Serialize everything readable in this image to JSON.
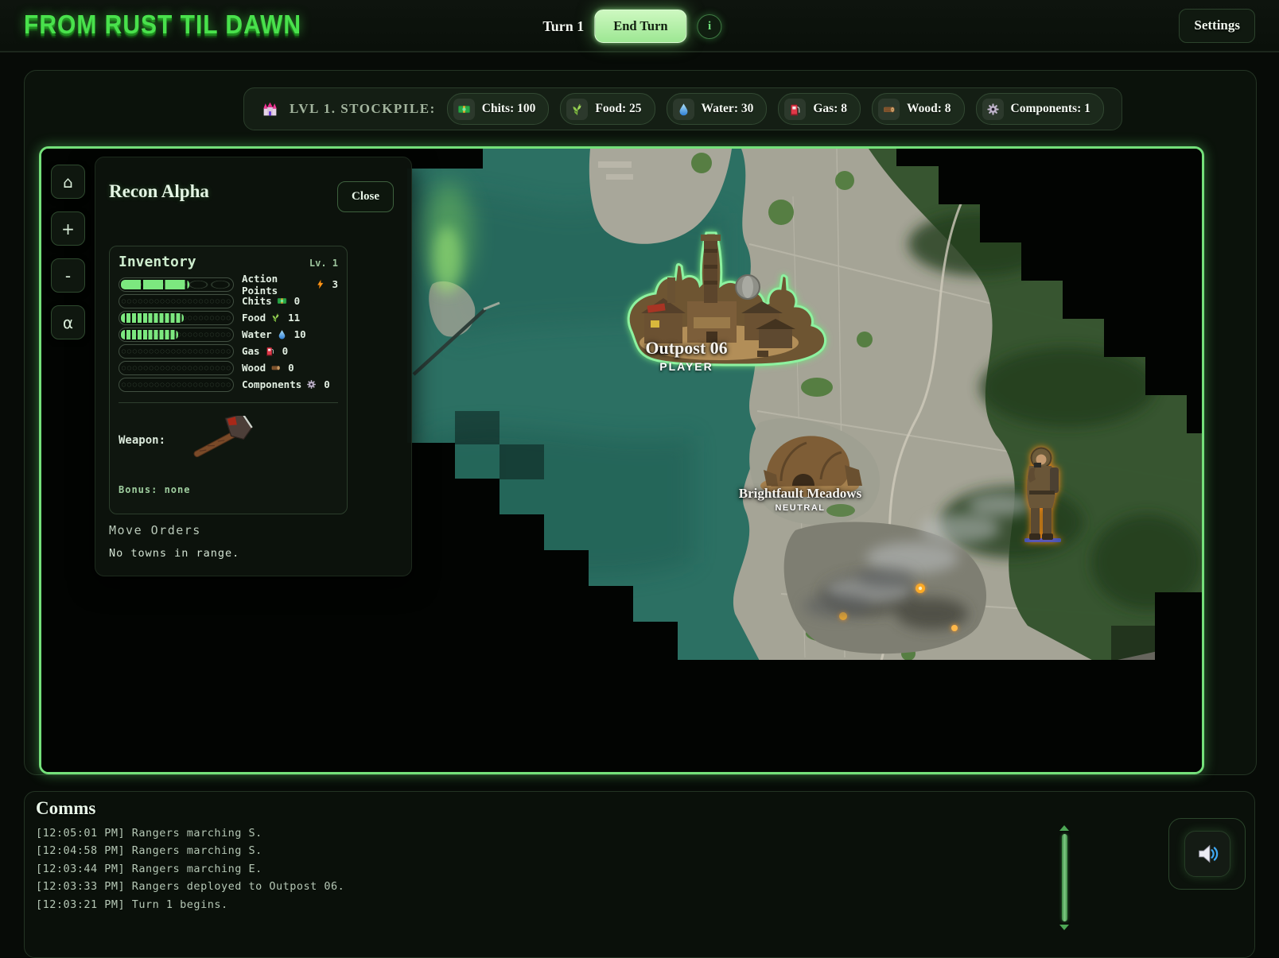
{
  "app": {
    "title": "FROM RUST TIL DAWN"
  },
  "topbar": {
    "turn_label": "Turn 1",
    "end_turn_label": "End Turn",
    "info_label": "i",
    "settings_label": "Settings"
  },
  "stockpile": {
    "icon": "castle-icon",
    "label": "LVL 1. STOCKPILE:",
    "items": [
      {
        "icon": "chits-icon",
        "label": "Chits: 100"
      },
      {
        "icon": "food-icon",
        "label": "Food: 25"
      },
      {
        "icon": "water-icon",
        "label": "Water: 30"
      },
      {
        "icon": "gas-icon",
        "label": "Gas: 8"
      },
      {
        "icon": "wood-icon",
        "label": "Wood: 8"
      },
      {
        "icon": "components-icon",
        "label": "Components: 1"
      }
    ]
  },
  "map": {
    "controls": [
      {
        "name": "home",
        "glyph": "⌂"
      },
      {
        "name": "zoom-in",
        "glyph": "+"
      },
      {
        "name": "zoom-out",
        "glyph": "-"
      },
      {
        "name": "alpha",
        "glyph": "α"
      }
    ],
    "towns": [
      {
        "name": "Outpost 06",
        "owner": "PLAYER"
      },
      {
        "name": "Brightfault Meadows",
        "owner": "NEUTRAL"
      }
    ],
    "unit_marker": "Recon Alpha ranger"
  },
  "unit_panel": {
    "title": "Recon Alpha",
    "close_label": "Close",
    "inventory": {
      "title": "Inventory",
      "level": "Lv. 1",
      "rows": [
        {
          "label": "Action Points",
          "icon": "lightning-icon",
          "value": "3",
          "fill_pct": 60
        },
        {
          "label": "Chits",
          "icon": "chits-icon",
          "value": "0",
          "fill_pct": 0
        },
        {
          "label": "Food",
          "icon": "food-icon",
          "value": "11",
          "fill_pct": 55
        },
        {
          "label": "Water",
          "icon": "water-icon",
          "value": "10",
          "fill_pct": 50
        },
        {
          "label": "Gas",
          "icon": "gas-icon",
          "value": "0",
          "fill_pct": 0
        },
        {
          "label": "Wood",
          "icon": "wood-icon",
          "value": "0",
          "fill_pct": 0
        },
        {
          "label": "Components",
          "icon": "gear-icon",
          "value": "0",
          "fill_pct": 0
        }
      ],
      "weapon_label": "Weapon:",
      "weapon_icon": "axe-icon",
      "bonus_label": "Bonus: none"
    },
    "move_orders_title": "Move Orders",
    "move_orders_status": "No towns in range."
  },
  "comms": {
    "title": "Comms",
    "mute_icon": "speaker-icon",
    "log": [
      "[12:05:01 PM] Rangers marching S.",
      "[12:04:58 PM] Rangers marching S.",
      "[12:03:44 PM] Rangers marching E.",
      "[12:03:33 PM] Rangers deployed to Outpost 06.",
      "[12:03:21 PM] Turn 1 begins."
    ]
  },
  "colors": {
    "accent_green": "#74e07a",
    "end_turn_green": "#b5f0ab",
    "player_glow_green": "#8df2a0",
    "unit_glow_orange": "#ff8a12",
    "water_teal": "#2c7063",
    "toxic_green": "#8ae060"
  }
}
